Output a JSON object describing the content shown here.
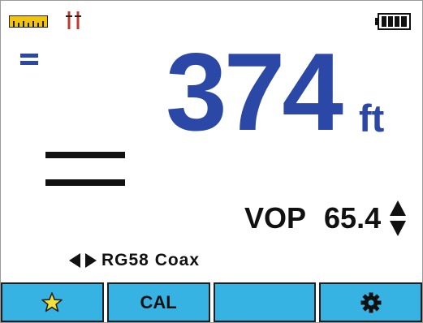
{
  "status_bar": {
    "icons": [
      "ruler-icon",
      "test-leads-icon",
      "battery-full-icon"
    ]
  },
  "display": {
    "units_indicator_icon": "equals-indicator-icon",
    "reading": "374",
    "unit": "ft",
    "cable_status_icon": "parallel-lines-icon"
  },
  "vop": {
    "label": "VOP",
    "value": "65.4",
    "adjust_icon": "up-down-arrows-icon"
  },
  "cable": {
    "selector_icon": "left-right-arrows-icon",
    "type": "RG58 Coax"
  },
  "softkeys": [
    {
      "icon": "star-icon",
      "label": ""
    },
    {
      "icon": "",
      "label": "CAL"
    },
    {
      "icon": "",
      "label": ""
    },
    {
      "icon": "gear-icon",
      "label": ""
    }
  ],
  "colors": {
    "reading": "#2b48a6",
    "softkey": "#36b3e3",
    "ruler": "#f1c40f",
    "leads": "#c0392b"
  }
}
